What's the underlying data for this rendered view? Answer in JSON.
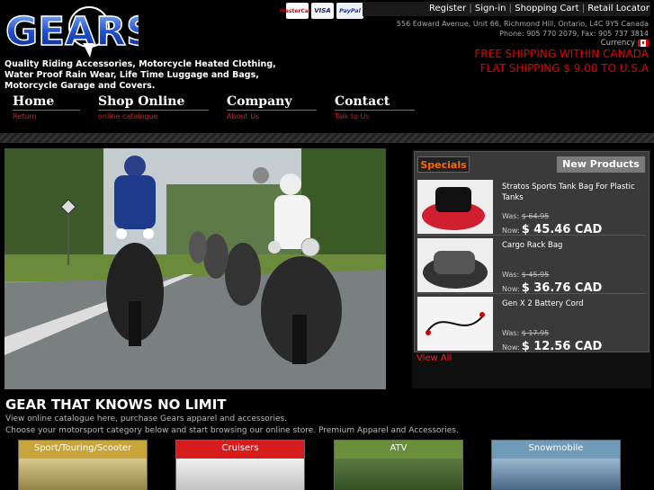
{
  "header": {
    "logo_text": "GEARS",
    "tagline": "Quality Riding Accessories, Motorcycle Heated Clothing, Water Proof Rain Wear, Life Time Luggage and Bags, Motorcycle Garage and Covers.",
    "payments": [
      "MasterCard",
      "VISA",
      "PayPal"
    ],
    "links": [
      "Register",
      "Sign-in",
      "Shopping Cart",
      "Retail Locator"
    ],
    "address_line1": "556 Edward Avenue, Unit 66, Richmond Hill, Ontario, L4C 9Y5 Canada",
    "address_line2": "Phone: 905 770 2079, Fax: 905 737 3814",
    "currency_label": "Currency",
    "shipping_line1": "FREE SHIPPING WITHIN CANADA",
    "shipping_line2": "FLAT SHIPPING $ 9.00 TO U.S.A"
  },
  "nav": [
    {
      "title": "Home",
      "sub": "Return"
    },
    {
      "title": "Shop Online",
      "sub": "online catalogue"
    },
    {
      "title": "Company",
      "sub": "About Us"
    },
    {
      "title": "Contact",
      "sub": "Talk to Us"
    }
  ],
  "specials": {
    "tab_specials": "Specials",
    "tab_new": "New Products",
    "was_label": "Was:",
    "now_label": "Now:",
    "products": [
      {
        "name": "Stratos Sports Tank Bag For Plastic Tanks",
        "was": "$ 64.95",
        "now": "$ 45.46 CAD"
      },
      {
        "name": "Cargo Rack Bag",
        "was": "$ 45.95",
        "now": "$ 36.76 CAD"
      },
      {
        "name": "Gen X 2 Battery Cord",
        "was": "$ 17.95",
        "now": "$ 12.56 CAD"
      }
    ],
    "view_all": "View All"
  },
  "intro": {
    "title": "GEAR THAT KNOWS NO LIMIT",
    "line1": "View online catalogue here, purchase Gears apparel and accessories.",
    "line2": "Choose your motorsport category below and start browsing our online store. Premium Apparel and Accessories."
  },
  "categories": [
    {
      "label": "Sport/Touring/Scooter",
      "color": "#c9a43a"
    },
    {
      "label": "Cruisers",
      "color": "#d61c1c"
    },
    {
      "label": "ATV",
      "color": "#6a8f3a"
    },
    {
      "label": "Snowmobile",
      "color": "#6f9bb8"
    }
  ],
  "colors": {
    "accent_red": "#e20000",
    "specials_orange": "#ff6600"
  }
}
